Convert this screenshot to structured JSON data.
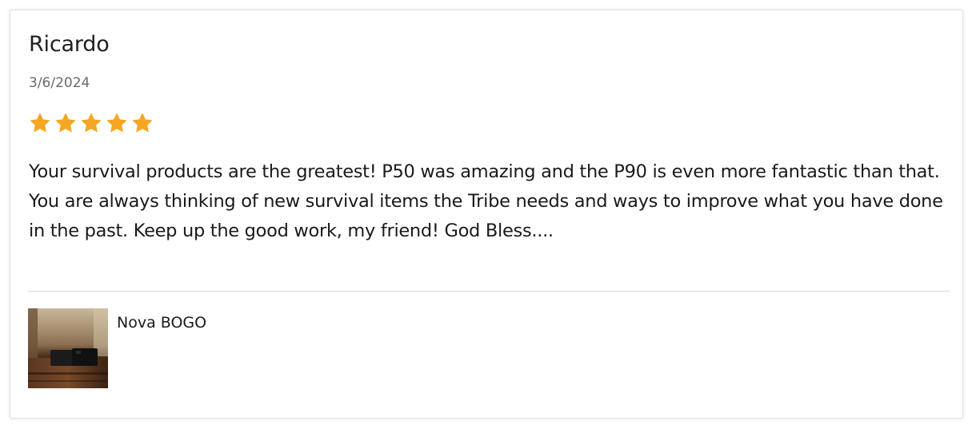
{
  "review": {
    "reviewer_name": "Ricardo",
    "date": "3/6/2024",
    "rating": 5,
    "rating_max": 5,
    "star_color": "#f5a623",
    "body": "Your survival products are the greatest! P50 was amazing and the P90 is even more fantastic than that.  You are always thinking of new survival items the Tribe needs and ways to improve what you have done in the past. Keep up the good work, my friend! God Bless...."
  },
  "product": {
    "name": "Nova BOGO",
    "image_icon": "product-thumbnail"
  }
}
